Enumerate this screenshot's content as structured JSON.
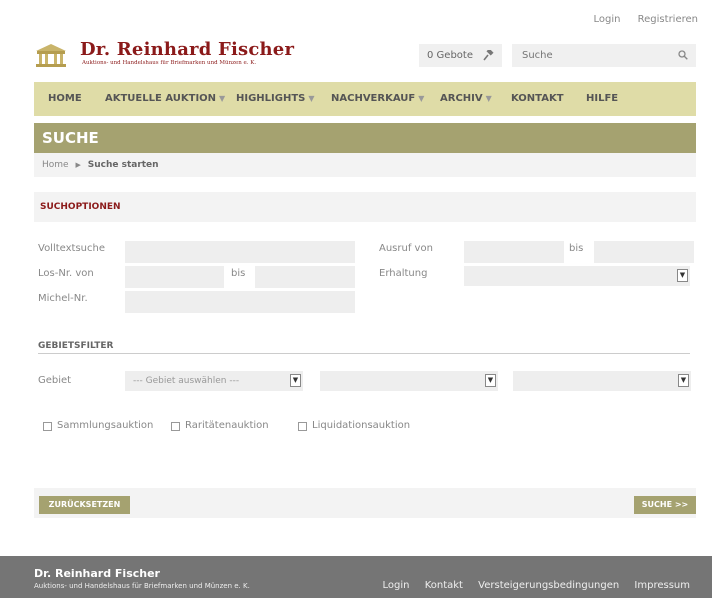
{
  "top_links": {
    "login": "Login",
    "register": "Registrieren"
  },
  "brand": {
    "name": "Dr. Reinhard Fischer",
    "subtitle": "Auktions- und Handelshaus für Briefmarken und Münzen e. K."
  },
  "header": {
    "bids": "0 Gebote",
    "search_placeholder": "Suche"
  },
  "nav": {
    "home": "HOME",
    "current_auction": "AKTUELLE AUKTION",
    "highlights": "HIGHLIGHTS",
    "after_sale": "NACHVERKAUF",
    "archive": "ARCHIV",
    "contact": "KONTAKT",
    "help": "HILFE"
  },
  "page_title": "SUCHE",
  "breadcrumb": {
    "home": "Home",
    "current": "Suche starten"
  },
  "options": {
    "heading": "SUCHOPTIONEN",
    "fulltext": "Volltextsuche",
    "lot_from": "Los-Nr. von",
    "lot_to": "bis",
    "michel": "Michel-Nr.",
    "call_from": "Ausruf von",
    "call_to": "bis",
    "condition": "Erhaltung"
  },
  "area_filter": {
    "heading": "GEBIETSFILTER",
    "label": "Gebiet",
    "select1": "--- Gebiet auswählen ---"
  },
  "checkboxes": {
    "collection": "Sammlungsauktion",
    "rarity": "Raritätenauktion",
    "liquidation": "Liquidationsauktion"
  },
  "buttons": {
    "reset": "ZURÜCKSETZEN",
    "search": "SUCHE >>"
  },
  "footer": {
    "name": "Dr. Reinhard Fischer",
    "subtitle": "Auktions- und Handelshaus für Briefmarken und Münzen e. K.",
    "login": "Login",
    "contact": "Kontakt",
    "terms": "Versteigerungsbedingungen",
    "imprint": "Impressum"
  },
  "colors": {
    "brand_red": "#8b1a1a",
    "nav_bg": "#dfdca7",
    "accent_olive": "#a5a270",
    "footer_bg": "#757575"
  }
}
